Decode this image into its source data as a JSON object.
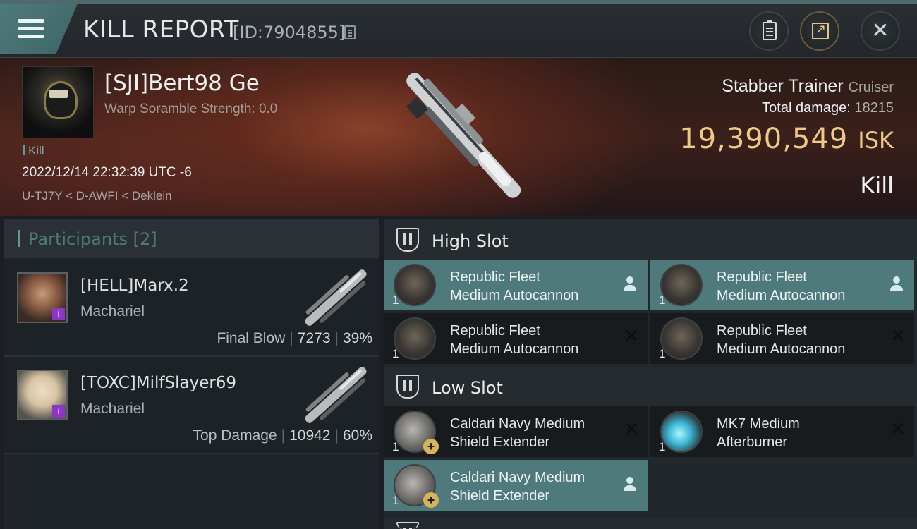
{
  "header": {
    "title": "KILL REPORT",
    "report_id": "[ID:7904855]",
    "buttons": [
      "menu-icon",
      "clipboard-icon",
      "share-icon",
      "close-icon"
    ],
    "close_glyph": "✕"
  },
  "victim": {
    "name": "[SJI]Bert98 Ge",
    "warp_scramble": "Warp Soramble Strength: 0.0",
    "kill_tag": "Kill",
    "datetime": "2022/12/14 22:32:39 UTC -6",
    "location": "U-TJ7Y < D-AWFI < Deklein",
    "ship_name": "Stabber Trainer",
    "ship_class": "Cruiser",
    "total_damage_label": "Total damage:",
    "total_damage": "18215",
    "isk_value": "19,390,549",
    "isk_unit": "ISK",
    "result": "Kill"
  },
  "participants": {
    "title": "Participants",
    "count": "[2]",
    "items": [
      {
        "name": "[HELL]Marx.2",
        "ship": "Machariel",
        "role": "Final Blow",
        "damage": "7273",
        "percent": "39%",
        "badge": "i"
      },
      {
        "name": "[TOXC]MilfSlayer69",
        "ship": "Machariel",
        "role": "Top Damage",
        "damage": "10942",
        "percent": "60%",
        "badge": "i"
      }
    ]
  },
  "slots": {
    "high": {
      "title": "High Slot",
      "modules": [
        {
          "line1": "Republic Fleet",
          "line2": "Medium Autocannon",
          "qty": "1",
          "state": "person"
        },
        {
          "line1": "Republic Fleet",
          "line2": "Medium Autocannon",
          "qty": "1",
          "state": "person"
        },
        {
          "line1": "Republic Fleet",
          "line2": "Medium Autocannon",
          "qty": "1",
          "state": "x"
        },
        {
          "line1": "Republic Fleet",
          "line2": "Medium Autocannon",
          "qty": "1",
          "state": "x"
        }
      ]
    },
    "low": {
      "title": "Low Slot",
      "modules": [
        {
          "line1": "Caldari Navy Medium",
          "line2": "Shield Extender",
          "qty": "1",
          "state": "x"
        },
        {
          "line1": "MK7 Medium",
          "line2": "Afterburner",
          "qty": "1",
          "state": "x"
        },
        {
          "line1": "Caldari Navy Medium",
          "line2": "Shield Extender",
          "qty": "1",
          "state": "person"
        }
      ]
    }
  },
  "glyphs": {
    "x": "✕",
    "plus": "+"
  },
  "colors": {
    "accent": "#4f7a7b",
    "isk": "#f1c987",
    "badge": "#8a37c7"
  }
}
